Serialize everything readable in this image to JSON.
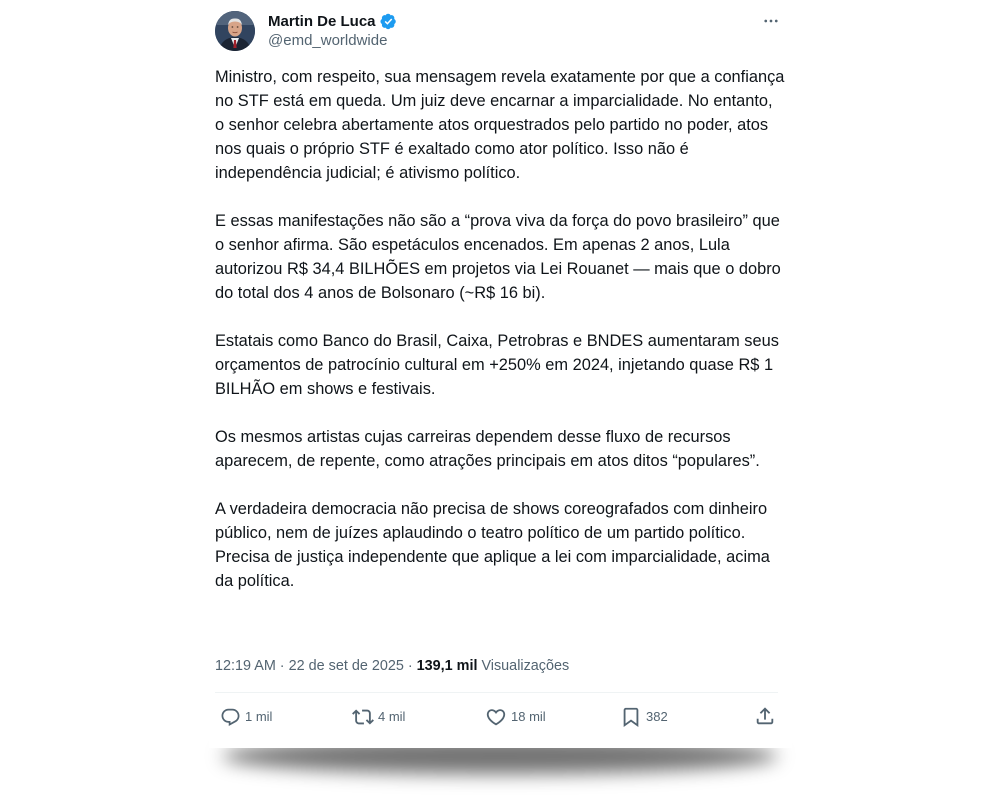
{
  "author": {
    "display_name": "Martin De Luca",
    "handle": "@emd_worldwide",
    "verified": true
  },
  "tweet": {
    "paragraphs": [
      "Ministro, com respeito, sua mensagem revela exatamente por que a confiança no STF está em queda. Um juiz deve encarnar a imparcialidade. No entanto, o senhor celebra abertamente atos orquestrados pelo partido no poder, atos nos quais o próprio STF é exaltado como ator político. Isso não é independência judicial; é ativismo político.",
      "E essas manifestações não são a “prova viva da força do povo brasileiro” que o senhor afirma. São espetáculos encenados. Em apenas 2 anos, Lula autorizou R$ 34,4 BILHÕES em projetos via Lei Rouanet — mais que o dobro do total dos 4 anos de Bolsonaro (~R$ 16 bi).",
      "Estatais como Banco do Brasil, Caixa, Petrobras e BNDES aumentaram seus orçamentos de patrocínio cultural em +250% em 2024, injetando quase R$ 1 BILHÃO em shows e festivais.",
      "Os mesmos artistas cujas carreiras dependem desse fluxo de recursos aparecem, de repente, como atrações principais em atos ditos “populares”.",
      "A verdadeira democracia não precisa de shows coreografados com dinheiro público, nem de juízes aplaudindo o teatro político de um partido político. Precisa de justiça independente que aplique a lei com imparcialidade, acima da política."
    ]
  },
  "meta": {
    "time": "12:19 AM",
    "separator": " · ",
    "date": "22 de set de 2025",
    "dot": " · ",
    "views_count": "139,1 mil",
    "views_label": " Visualizações"
  },
  "actions": {
    "replies": "1 mil",
    "reposts": "4 mil",
    "likes": "18 mil",
    "bookmarks": "382"
  },
  "colors": {
    "text": "#0f1419",
    "secondary": "#536471",
    "verified": "#1d9bf0",
    "divider": "#eff3f4"
  },
  "icons": [
    "verified-badge-icon",
    "more-icon",
    "reply-icon",
    "repost-icon",
    "like-icon",
    "bookmark-icon",
    "share-icon"
  ]
}
